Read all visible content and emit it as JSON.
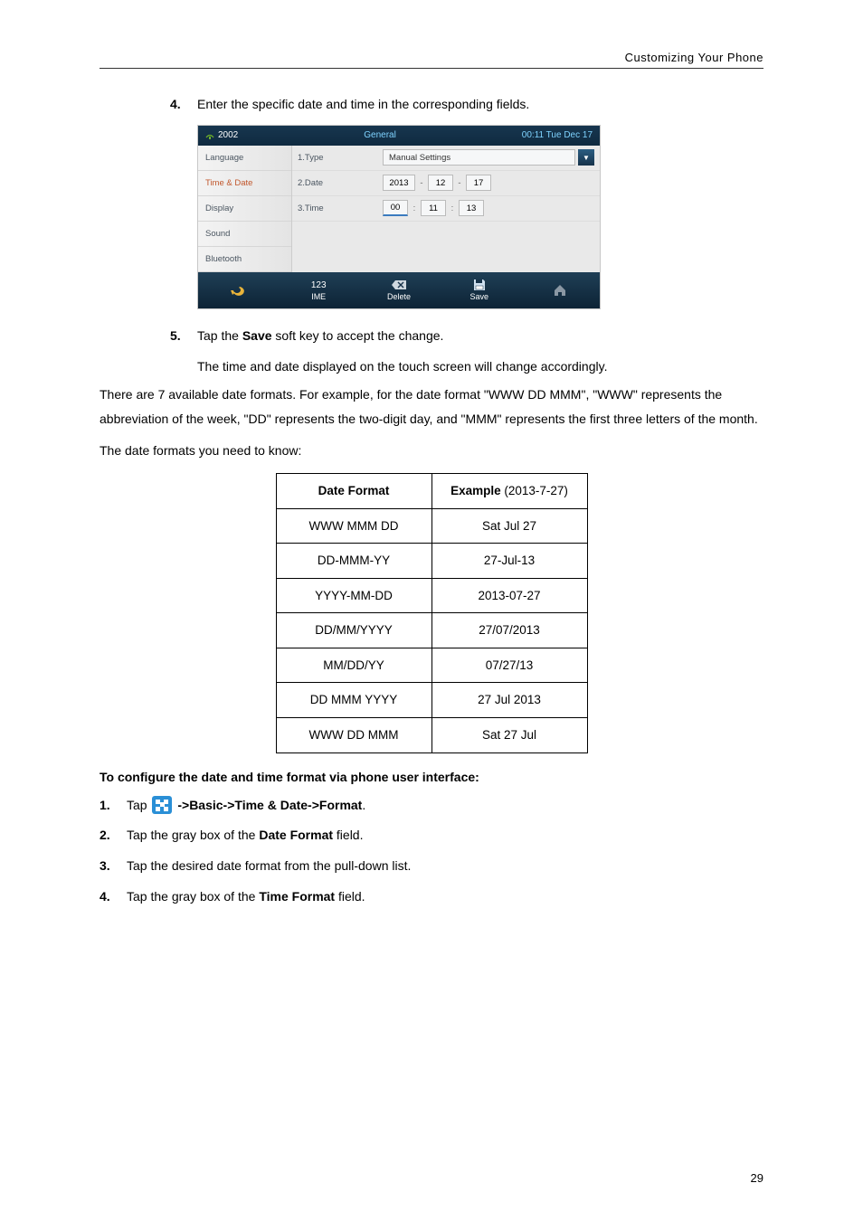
{
  "header": {
    "section_title": "Customizing Your Phone"
  },
  "steps_a": {
    "four": {
      "num": "4.",
      "text": "Enter the specific date and time in the corresponding fields."
    },
    "five": {
      "num": "5.",
      "text": "Tap the ",
      "bold": "Save",
      "text2": " soft key to accept the change.",
      "sub": "The time and date displayed on the touch screen will change accordingly."
    }
  },
  "phone": {
    "ext": "2002",
    "title": "General",
    "clock": "00:11 Tue Dec 17",
    "sidebar": {
      "language": "Language",
      "time_date": "Time & Date",
      "display": "Display",
      "sound": "Sound",
      "bluetooth": "Bluetooth"
    },
    "rows": {
      "type": {
        "label": "1.Type",
        "value": "Manual Settings"
      },
      "date": {
        "label": "2.Date",
        "y": "2013",
        "m": "12",
        "d": "17",
        "sep": "-"
      },
      "time": {
        "label": "3.Time",
        "h": "00",
        "mi": "11",
        "s": "13",
        "sep": ":"
      }
    },
    "softkeys": {
      "ime": {
        "top": "123",
        "label": "IME"
      },
      "delete": {
        "label": "Delete"
      },
      "save": {
        "label": "Save"
      }
    }
  },
  "explain": {
    "p1": "There are 7 available date formats. For example, for the date format \"WWW DD MMM\", \"WWW\" represents the abbreviation of the week, \"DD\" represents the two-digit day, and \"MMM\" represents the first three letters of the month.",
    "p2": "The date formats you need to know:"
  },
  "fmt_table": {
    "h1": "Date Format",
    "h2_pre": "Example",
    "h2_suf": " (2013-7-27)",
    "rows": [
      {
        "f": "WWW MMM DD",
        "e": "Sat Jul 27"
      },
      {
        "f": "DD-MMM-YY",
        "e": "27-Jul-13"
      },
      {
        "f": "YYYY-MM-DD",
        "e": "2013-07-27"
      },
      {
        "f": "DD/MM/YYYY",
        "e": "27/07/2013"
      },
      {
        "f": "MM/DD/YY",
        "e": "07/27/13"
      },
      {
        "f": "DD MMM YYYY",
        "e": "27 Jul 2013"
      },
      {
        "f": "WWW DD MMM",
        "e": "Sat 27 Jul"
      }
    ]
  },
  "configure": {
    "title": "To configure the date and time format via phone user interface:",
    "s1": {
      "num": "1.",
      "pre": "Tap ",
      "path": " ->Basic->Time & Date->Format",
      "dot": "."
    },
    "s2": {
      "num": "2.",
      "pre": "Tap the gray box of the ",
      "bold": "Date Format",
      "suf": " field."
    },
    "s3": {
      "num": "3.",
      "text": "Tap the desired date format from the pull-down list."
    },
    "s4": {
      "num": "4.",
      "pre": "Tap the gray box of the ",
      "bold": "Time Format",
      "suf": " field."
    }
  },
  "page": "29"
}
